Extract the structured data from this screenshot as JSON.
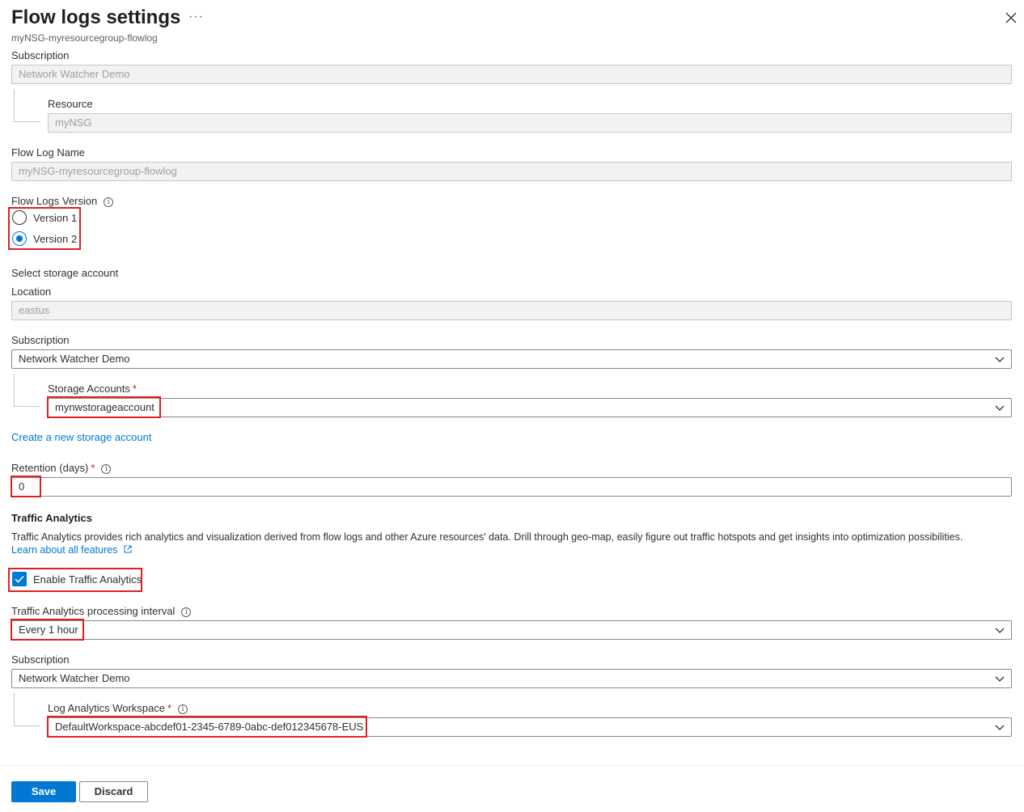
{
  "header": {
    "title": "Flow logs settings",
    "more_label": "···",
    "subtitle": "myNSG-myresourcegroup-flowlog"
  },
  "subscription1": {
    "label": "Subscription",
    "value": "Network Watcher Demo"
  },
  "resource": {
    "label": "Resource",
    "value": "myNSG"
  },
  "flow_log_name": {
    "label": "Flow Log Name",
    "value": "myNSG-myresourcegroup-flowlog"
  },
  "flow_logs_version": {
    "label": "Flow Logs Version",
    "options": [
      {
        "label": "Version 1",
        "selected": false
      },
      {
        "label": "Version 2",
        "selected": true
      }
    ]
  },
  "storage": {
    "section_label": "Select storage account",
    "location_label": "Location",
    "location_value": "eastus",
    "subscription_label": "Subscription",
    "subscription_value": "Network Watcher Demo",
    "accounts_label": "Storage Accounts",
    "accounts_value": "mynwstorageaccount",
    "create_link": "Create a new storage account"
  },
  "retention": {
    "label": "Retention (days)",
    "value": "0"
  },
  "traffic_analytics": {
    "title": "Traffic Analytics",
    "description": "Traffic Analytics provides rich analytics and visualization derived from flow logs and other Azure resources' data. Drill through geo-map, easily figure out traffic hotspots and get insights into optimization possibilities.",
    "learn_link": "Learn about all features",
    "enable_label": "Enable Traffic Analytics",
    "enabled": true,
    "interval_label": "Traffic Analytics processing interval",
    "interval_value": "Every 1 hour",
    "subscription_label": "Subscription",
    "subscription_value": "Network Watcher Demo",
    "workspace_label": "Log Analytics Workspace",
    "workspace_value": "DefaultWorkspace-abcdef01-2345-6789-0abc-def012345678-EUS"
  },
  "required_mark": "*",
  "info_glyph": "i",
  "footer": {
    "save_label": "Save",
    "discard_label": "Discard"
  },
  "colors": {
    "accent": "#0078d4",
    "highlight": "#e02020",
    "required": "#a4262c"
  }
}
